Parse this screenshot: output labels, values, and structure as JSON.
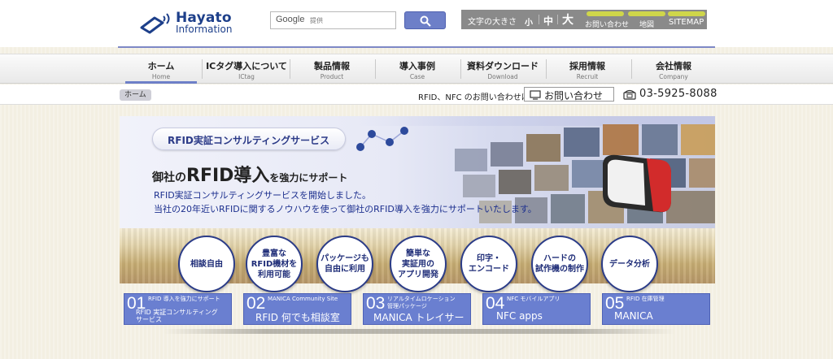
{
  "header": {
    "logo_line1": "Hayato",
    "logo_line2": "Information",
    "search_brand": "Google",
    "search_powered": "提供",
    "font_size_label": "文字の大きさ",
    "font_small": "小",
    "font_mid": "中",
    "font_large": "大",
    "links": [
      "お問い合わせ",
      "地図",
      "SITEMAP"
    ]
  },
  "nav": [
    {
      "jp": "ホーム",
      "en": "Home"
    },
    {
      "jp": "ICタグ導入について",
      "en": "ICtag"
    },
    {
      "jp": "製品情報",
      "en": "Product"
    },
    {
      "jp": "導入事例",
      "en": "Case"
    },
    {
      "jp": "資料ダウンロード",
      "en": "Download"
    },
    {
      "jp": "採用情報",
      "en": "Recruit"
    },
    {
      "jp": "会社情報",
      "en": "Company"
    }
  ],
  "strip": {
    "breadcrumb": "ホーム",
    "contact_lead": "RFID、NFC のお問い合わせは",
    "contact_button": "お問い合わせ",
    "phone": "03-5925-8088"
  },
  "hero": {
    "pill": "RFID実証コンサルティングサービス",
    "headline_a": "御社の",
    "headline_b": "RFID導入",
    "headline_c": "を強力にサポート",
    "line1": "RFID実証コンサルティングサービスを開始しました。",
    "line2": "当社の20年近いRFIDに関するノウハウを使って御社のRFID導入を強力にサポートいたします。",
    "circles": [
      "相談自由",
      "豊富な\nRFID機材を\n利用可能",
      "パッケージも\n自由に利用",
      "簡単な\n実証用の\nアプリ開発",
      "印字・\nエンコード",
      "ハードの\n試作機の制作",
      "データ分析"
    ]
  },
  "features": [
    {
      "num": "01",
      "sub": "RFID 導入を強力にサポート",
      "title": "RFID 実証コンサルティング\nサービス"
    },
    {
      "num": "02",
      "sub": "MANICA Community Site",
      "title": "RFID 何でも相談室"
    },
    {
      "num": "03",
      "sub": "リアルタイムロケーション\n管理パッケージ",
      "title": "MANICA トレイサー"
    },
    {
      "num": "04",
      "sub": "NFC モバイルアプリ",
      "title": "NFC apps"
    },
    {
      "num": "05",
      "sub": "RFID 在庫管理",
      "title": "MANICA"
    }
  ],
  "colors": {
    "brand_blue": "#1d3f8a",
    "accent": "#6d7fc8",
    "feature_blue": "#6a7fd0",
    "util_gray": "#8a8a8a",
    "util_pill": "#cfd64a"
  }
}
